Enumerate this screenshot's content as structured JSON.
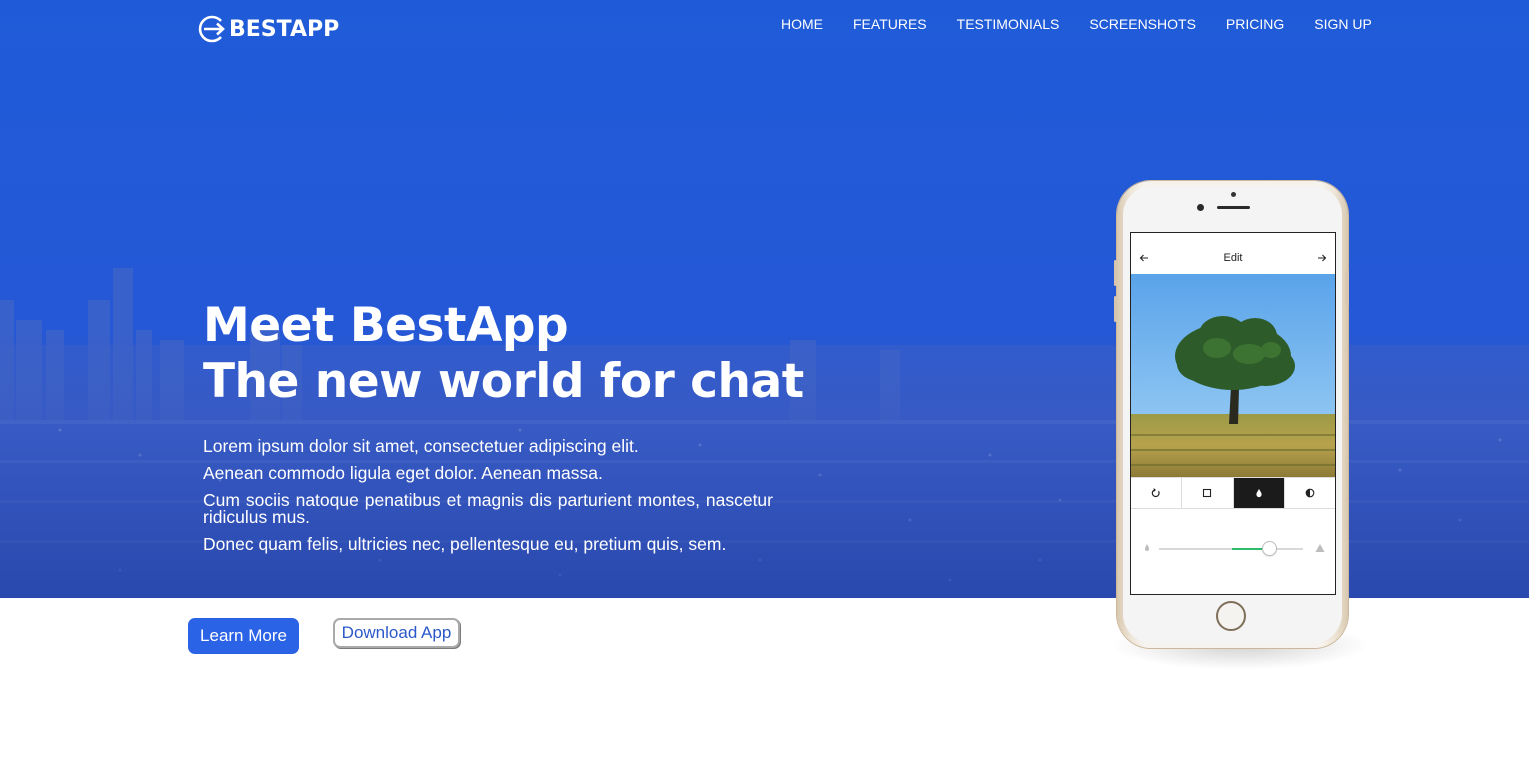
{
  "brand": {
    "logo_text": "BESTAPP",
    "logo_icon": "arrow-circle-icon"
  },
  "nav": {
    "items": [
      {
        "label": "HOME"
      },
      {
        "label": "FEATURES"
      },
      {
        "label": "TESTIMONIALS"
      },
      {
        "label": "SCREENSHOTS"
      },
      {
        "label": "PRICING"
      },
      {
        "label": "SIGN UP"
      }
    ]
  },
  "hero": {
    "title_line1": "Meet BestApp",
    "title_line2": "The new world for chat",
    "paragraphs": [
      "Lorem ipsum dolor sit amet, consectetuer adipiscing elit.",
      "Aenean commodo ligula eget dolor. Aenean massa.",
      "Cum sociis natoque penatibus et magnis dis parturient montes, nascetur ridiculus mus.",
      "Donec quam felis, ultricies nec, pellentesque eu, pretium quis, sem."
    ],
    "primary_button": "Learn More",
    "secondary_button": "Download App"
  },
  "phone_app": {
    "title": "Edit",
    "back_icon": "arrow-left-icon",
    "forward_icon": "arrow-right-icon",
    "tools": [
      {
        "icon": "rotate-icon",
        "active": false
      },
      {
        "icon": "crop-square-icon",
        "active": false
      },
      {
        "icon": "drop-icon",
        "active": true
      },
      {
        "icon": "contrast-icon",
        "active": false
      }
    ],
    "slider_value_fraction": 0.77
  },
  "colors": {
    "hero_blue": "#1f5bd8",
    "primary_button": "#2b63e6",
    "slider_fill": "#2dbb6a"
  }
}
